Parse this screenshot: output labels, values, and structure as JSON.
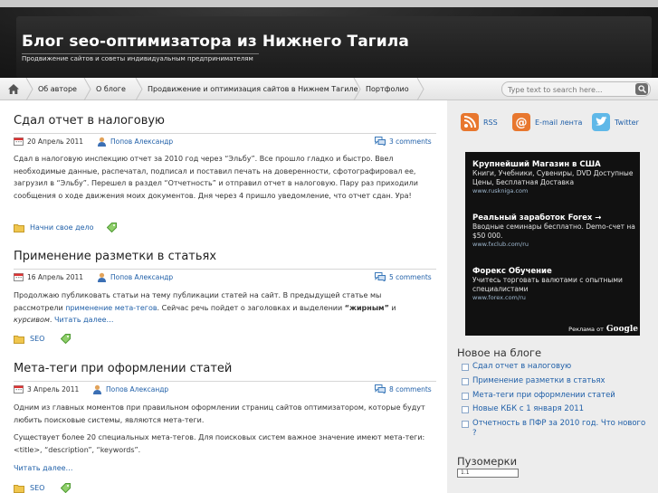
{
  "site": {
    "title": "Блог seo-оптимизатора из Нижнего Тагила",
    "description": "Продвижение сайтов и советы индивидуальным предпринимателям"
  },
  "nav": {
    "items": [
      "Об авторе",
      "О блоге",
      "Продвижение и оптимизация сайтов в Нижнем Тагиле",
      "Портфолио"
    ]
  },
  "search": {
    "placeholder": "Type text to search here..."
  },
  "posts": [
    {
      "title": "Сдал отчет в налоговую",
      "date": "20 Апрель 2011",
      "author": "Попов Александр",
      "comments": "3 comments",
      "body": "Сдал в налоговую инспекцию отчет за 2010 год через “Эльбу”. Все прошло гладко и быстро. Ввел необходимые данные, распечатал, подписал и поставил печать на доверенности, сфотографировал ее, загрузил в “Эльбу”. Перешел в раздел “Отчетность” и отправил отчет в налоговую. Пару раз приходили сообщения о ходе движения моих документов. Дня через 4 пришло уведомление, что отчет сдан. Ура!",
      "category": "Начни свое дело"
    },
    {
      "title": "Применение разметки в статьях",
      "date": "16 Апрель 2011",
      "author": "Попов Александр",
      "comments": "5 comments",
      "body_a": "Продолжаю публиковать статьи на тему публикации статей на сайт. В предыдущей статье мы рассмотрели ",
      "body_link": "применение мета-тегов",
      "body_b": ". Сейчас речь пойдет о заголовках и выделении ",
      "body_bold": "“жирным”",
      "body_c": " и ",
      "body_italic": "курсивом",
      "body_d": ". ",
      "read_more": "Читать далее…",
      "category": "SEO"
    },
    {
      "title": "Мета-теги при оформлении статей",
      "date": "3 Апрель 2011",
      "author": "Попов Александр",
      "comments": "8 comments",
      "body_p1": "Одним из главных моментов при правильном оформлении страниц сайтов оптимизатором, которые будут любить поисковые системы, являются мета-теги.",
      "body_p2": "Существует более 20 специальных мета-тегов. Для поисковых систем важное значение имеют мета-теги: <title>, “description”, “keywords”.",
      "read_more": "Читать далее…",
      "category": "SEO"
    }
  ],
  "sidebar": {
    "social": [
      {
        "label": "RSS",
        "icon": "rss-icon",
        "color": "#e8772e"
      },
      {
        "label": "E-mail лента",
        "icon": "email-icon",
        "color": "#e8772e"
      },
      {
        "label": "Twitter",
        "icon": "twitter-icon",
        "color": "#5fb8e8"
      }
    ],
    "ads": [
      {
        "title": "Крупнейший Магазин в США",
        "text": "Книги, Учебники, Сувениры, DVD Доступные Цены, Бесплатная Доставка",
        "url": "www.ruskniga.com"
      },
      {
        "title": "Реальный заработок Forex →",
        "text": "Вводные семинары бесплатно. Demo-счет на $50 000.",
        "url": "www.fxclub.com/ru"
      },
      {
        "title": "Форекс Обучение",
        "text": "Учитесь торговать валютами с опытными специалистами",
        "url": "www.forex.com/ru"
      }
    ],
    "ads_by": "Реклама от",
    "ads_brand": "Google",
    "new_title": "Новое на блоге",
    "new_items": [
      "Сдал отчет в налоговую",
      "Применение разметки в статьях",
      "Мета-теги при оформлении статей",
      "Новые КБК с 1 января 2011",
      "Отчетность в ПФР за 2010 год. Что нового ?"
    ],
    "puzo_title": "Пузомерки",
    "puzo_badge": "1.1"
  }
}
